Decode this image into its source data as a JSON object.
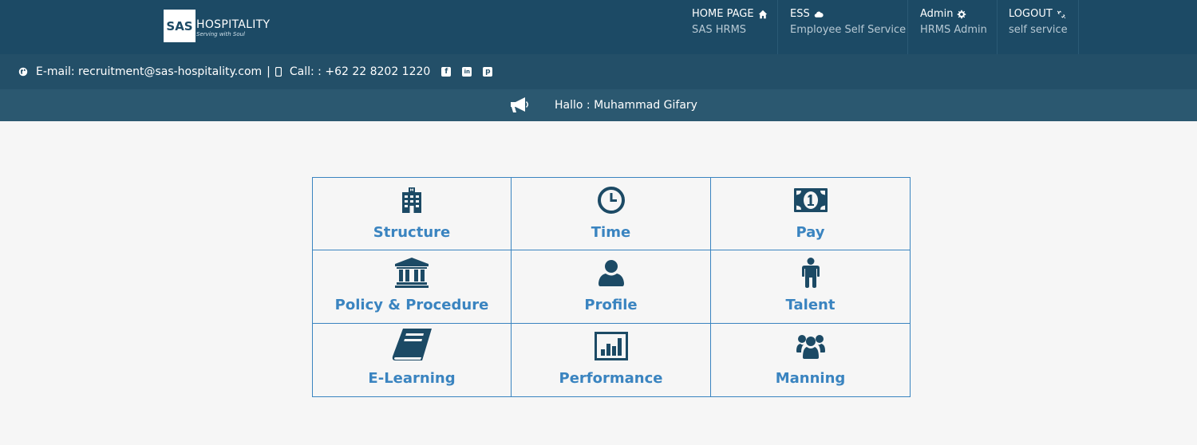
{
  "header": {
    "logo_mark": "SAS",
    "logo_name": "HOSPITALITY",
    "logo_tagline": "Serving with Soul",
    "nav": [
      {
        "title": "HOME PAGE",
        "subtitle": "SAS HRMS",
        "icon": "home-icon"
      },
      {
        "title": "ESS",
        "subtitle": "Employee Self Service",
        "icon": "cloud-icon"
      },
      {
        "title": "Admin",
        "subtitle": "HRMS Admin",
        "icon": "gear-icon"
      },
      {
        "title": "LOGOUT",
        "subtitle": "self service",
        "icon": "unlink-icon"
      }
    ]
  },
  "contact": {
    "email": "E-mail: recruitment@sas-hospitality.com",
    "separator": "|",
    "phone": "Call: : +62 22 8202 1220",
    "social": [
      "facebook-icon",
      "linkedin-icon",
      "pinterest-icon"
    ]
  },
  "greeting": {
    "text": "Hallo : Muhammad Gifary"
  },
  "tiles": [
    {
      "label": "Structure",
      "icon": "building-icon"
    },
    {
      "label": "Time",
      "icon": "clock-icon"
    },
    {
      "label": "Pay",
      "icon": "money-icon"
    },
    {
      "label": "Policy & Procedure",
      "icon": "institution-icon"
    },
    {
      "label": "Profile",
      "icon": "user-icon"
    },
    {
      "label": "Talent",
      "icon": "male-icon"
    },
    {
      "label": "E-Learning",
      "icon": "book-icon"
    },
    {
      "label": "Performance",
      "icon": "bar-chart-icon"
    },
    {
      "label": "Manning",
      "icon": "users-icon"
    }
  ],
  "colors": {
    "topbar": "#1c4a65",
    "infobar": "#234f68",
    "hallobar": "#2b5870",
    "tile_border": "#3a84c0",
    "tile_label": "#3a84c0",
    "icon": "#1c4a65",
    "background": "#f6f6f6"
  }
}
